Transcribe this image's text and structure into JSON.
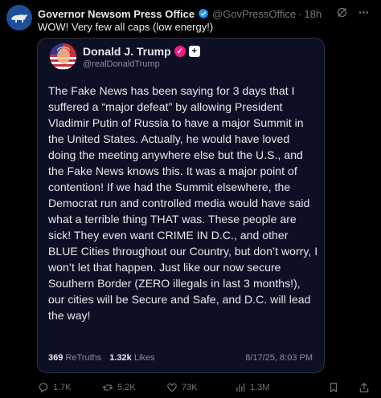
{
  "post": {
    "author_name": "Governor Newsom Press Office",
    "author_handle": "@GovPressOffice",
    "separator": "·",
    "time": "18h",
    "text": "WOW! Very few all caps (low energy!)"
  },
  "quoted": {
    "author_name": "Donald J. Trump",
    "author_handle": "@realDonaldTrump",
    "body": "The Fake News has been saying for 3 days that I suffered a “major defeat” by allowing President Vladimir Putin of Russia to have a major Summit in the United States. Actually, he would have loved doing the meeting anywhere else but the U.S., and the Fake News knows this. It was a major point of contention! If we had the Summit elsewhere, the Democrat run and controlled media would have said what a terrible thing THAT was. These people are sick! They even want CRIME IN D.C., and other BLUE Cities throughout our Country, but don’t worry, I won’t let that happen. Just like our now secure Southern Border (ZERO illegals in last 3 months!), our cities will be Secure and Safe, and D.C. will lead the way!",
    "retruths_count": "369",
    "retruths_label": "ReTruths",
    "likes_count": "1.32k",
    "likes_label": "Likes",
    "date": "8/17/25, 8:03 PM"
  },
  "actions": {
    "replies": "1.7K",
    "reposts": "5.2K",
    "likes": "73K",
    "views": "1.3M"
  },
  "colors": {
    "background": "#000000",
    "card_bg": "#0d0f25",
    "verified_blue": "#1d9bf0",
    "muted": "#71767b"
  }
}
